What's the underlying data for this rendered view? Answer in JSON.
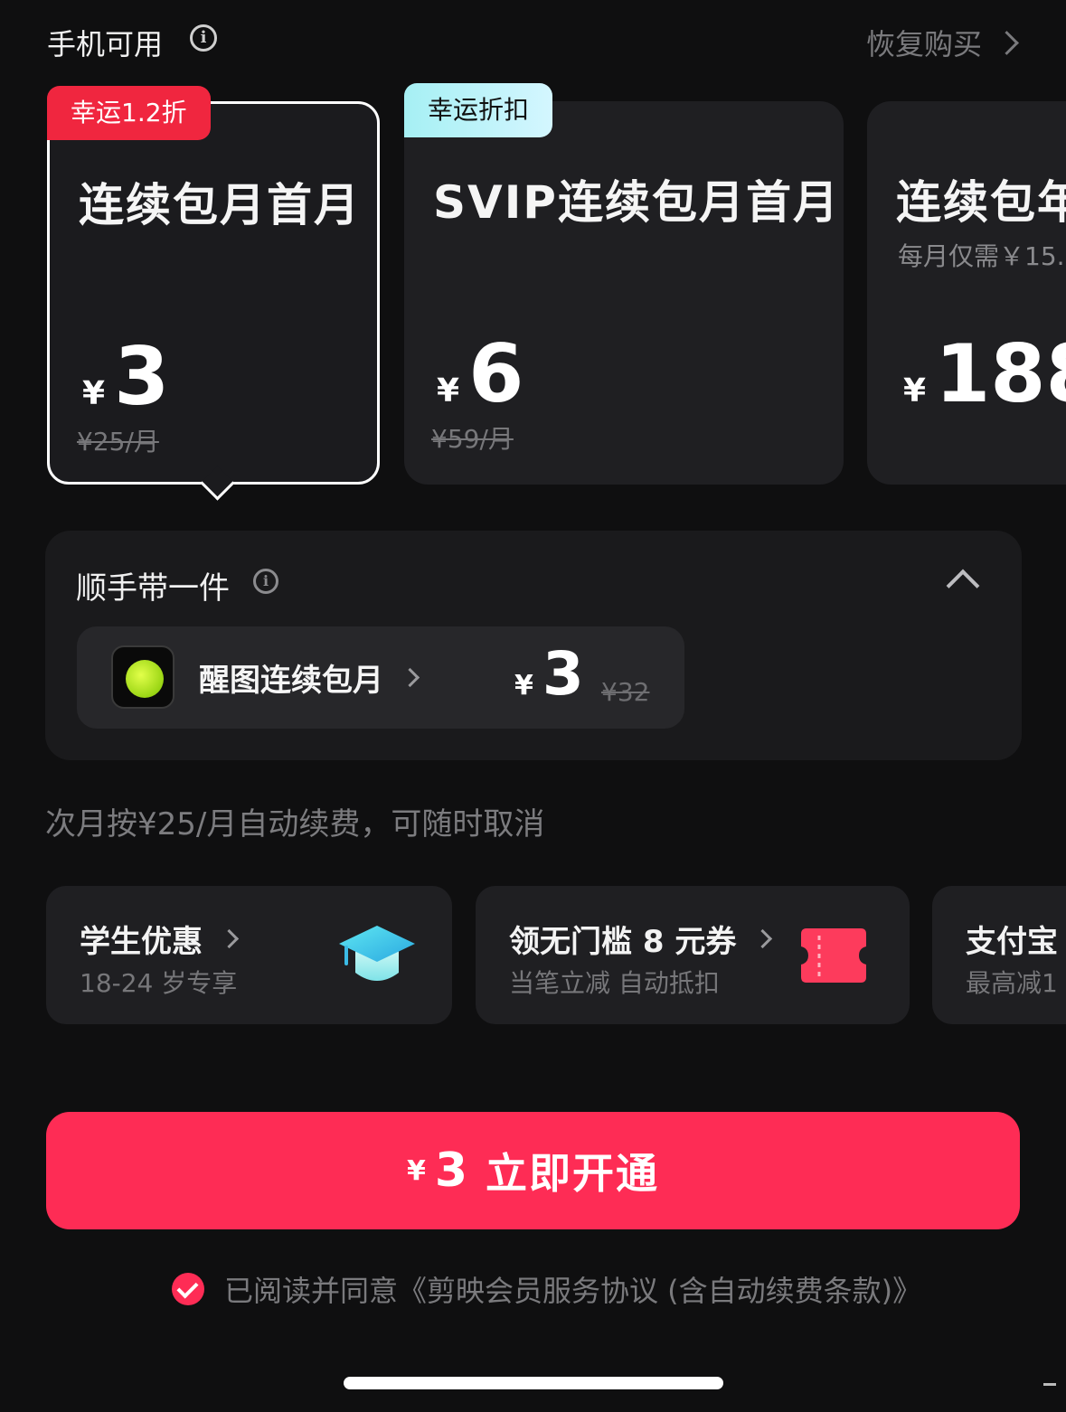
{
  "header": {
    "title": "手机可用",
    "info_glyph": "i",
    "restore_label": "恢复购买"
  },
  "plans": [
    {
      "badge": "幸运1.2折",
      "title": "连续包月首月",
      "subtitle": "",
      "currency": "¥",
      "price": "3",
      "original": "¥25/月",
      "selected": true
    },
    {
      "badge": "幸运折扣",
      "title": "SVIP连续包月首月",
      "subtitle": "",
      "currency": "¥",
      "price": "6",
      "original": "¥59/月",
      "selected": false
    },
    {
      "badge": "",
      "title": "连续包年",
      "subtitle": "每月仅需￥15.",
      "currency": "¥",
      "price": "188",
      "original": "",
      "selected": false
    }
  ],
  "addon": {
    "title": "顺手带一件",
    "info_glyph": "i",
    "item_name": "醒图连续包月",
    "currency": "¥",
    "price": "3",
    "original": "¥32"
  },
  "renewal_note": "次月按¥25/月自动续费，可随时取消",
  "promos": [
    {
      "title": "学生优惠",
      "subtitle": "18-24 岁专享",
      "icon": "graduation-cap-icon"
    },
    {
      "title": "领无门槛 8 元券",
      "subtitle": "当笔立减 自动抵扣",
      "icon": "ticket-icon"
    },
    {
      "title": "支付宝",
      "subtitle": "最高减1"
    }
  ],
  "cta": {
    "currency": "¥",
    "amount": "3",
    "label": "立即开通"
  },
  "agreement": {
    "text": "已阅读并同意《剪映会员服务协议 (含自动续费条款)》"
  },
  "colors": {
    "accent": "#fe2c55",
    "badge_red": "#f0263f",
    "badge_cyan": "#a6f0f4",
    "background": "#0f0f10",
    "card": "#1f1f22"
  }
}
